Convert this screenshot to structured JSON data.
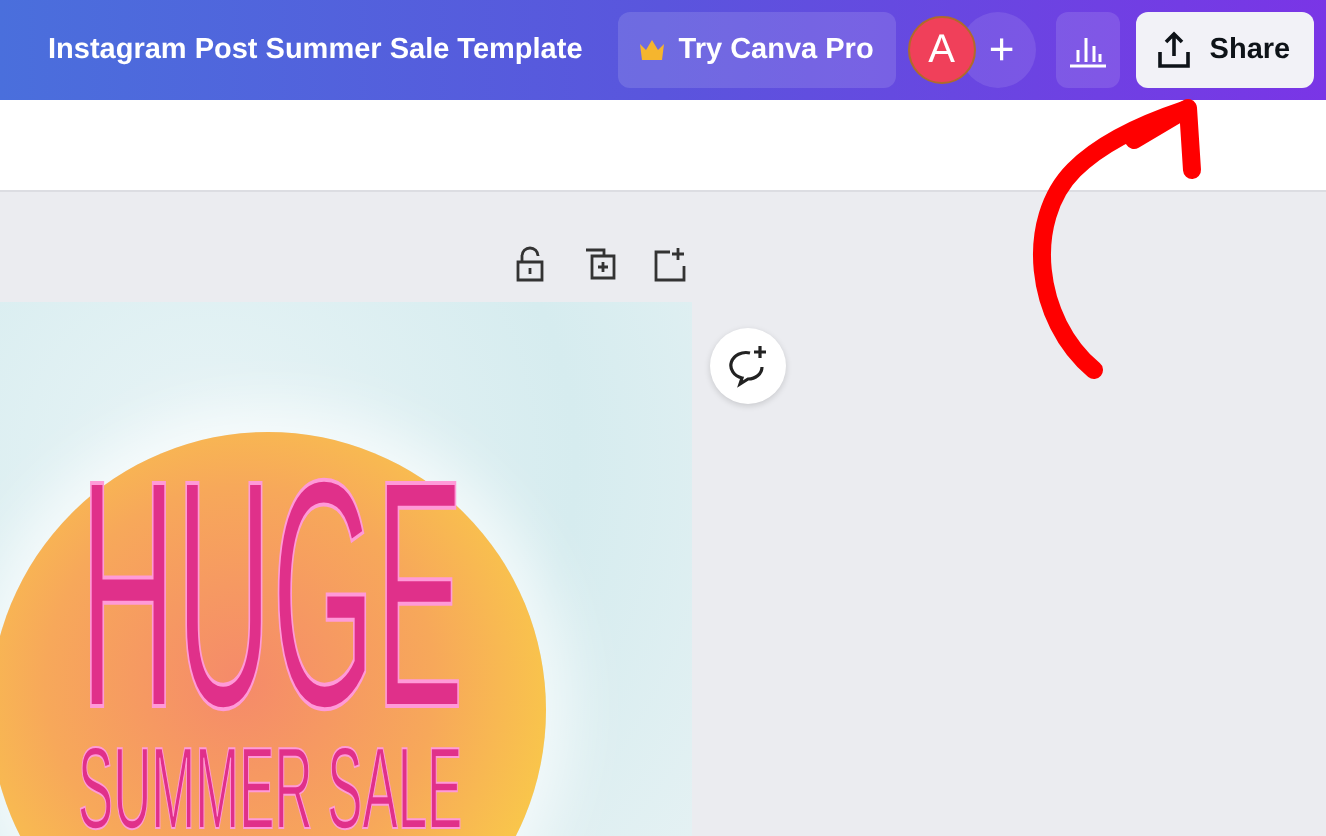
{
  "header": {
    "title": "Instagram Post Summer Sale Template",
    "pro_button": "Try Canva Pro",
    "avatar": "A",
    "add_button": "+",
    "share_button": "Share"
  },
  "design": {
    "headline": "HUGE",
    "subheadline": "SUMMER SALE"
  }
}
